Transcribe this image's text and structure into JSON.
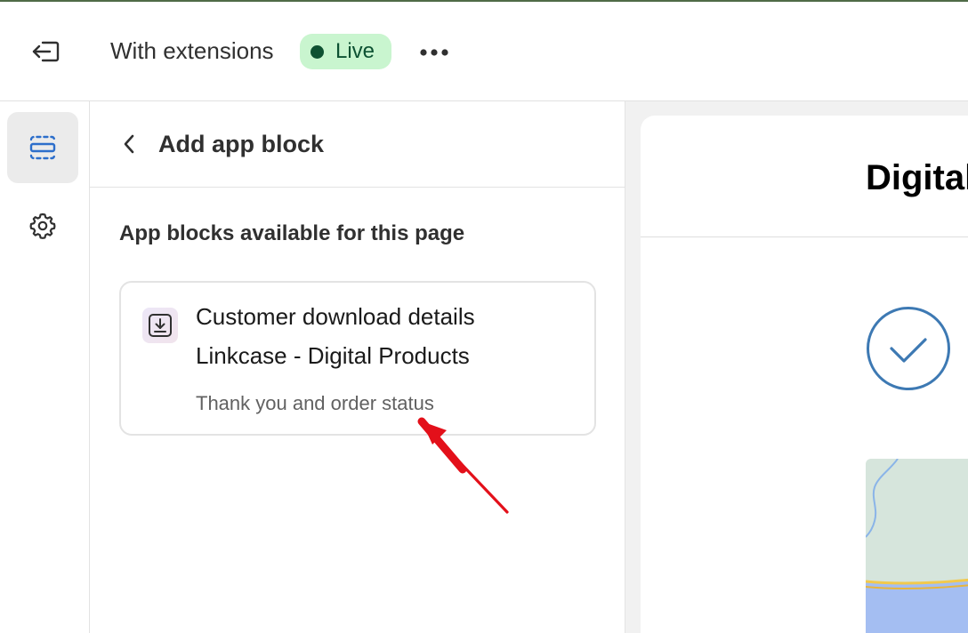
{
  "topbar": {
    "theme_name": "With extensions",
    "status_badge": "Live",
    "status_color": "#0f5132",
    "icons": {
      "exit": "exit-icon",
      "more": "more-horizontal-icon"
    }
  },
  "rail": {
    "items": [
      {
        "name": "sections",
        "icon": "sections-icon",
        "active": true,
        "accent": "#2c6ecb"
      },
      {
        "name": "settings",
        "icon": "gear-icon",
        "active": false
      }
    ]
  },
  "panel": {
    "title": "Add app block",
    "section_heading": "App blocks available for this page",
    "blocks": [
      {
        "icon": "download-icon",
        "name": "Customer download details",
        "app": "Linkcase - Digital Products",
        "page": "Thank you and order status"
      }
    ]
  },
  "preview": {
    "title": "Digital",
    "check_color": "#3d79b3"
  },
  "annotation": {
    "arrow_color": "#e3101a"
  }
}
